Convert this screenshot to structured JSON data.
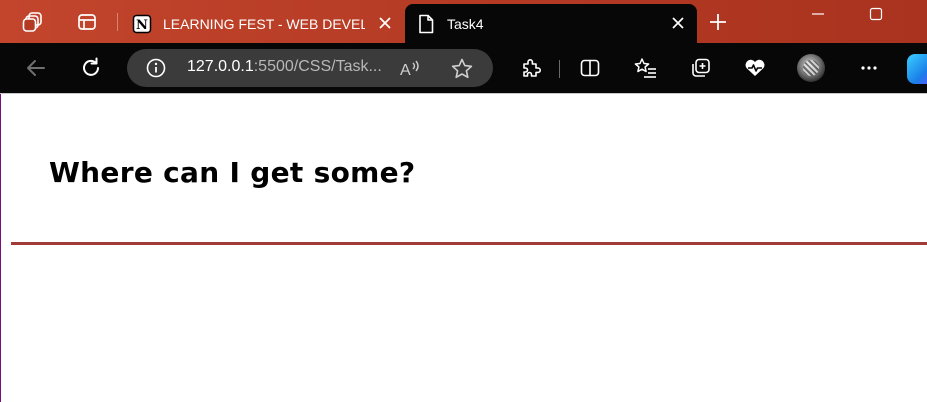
{
  "colors": {
    "tabstrip": "#b43a24",
    "toolbar": "#070707",
    "address_bar": "#3b3b3b",
    "rule": "#a23a3a"
  },
  "browser": {
    "tabs": [
      {
        "title": "LEARNING FEST - WEB DEVELOP",
        "favicon": "notion-icon",
        "active": false
      },
      {
        "title": "Task4",
        "favicon": "file-icon",
        "active": true
      }
    ],
    "address": {
      "host": "127.0.0.1",
      "path": ":5500/CSS/Task..."
    },
    "icons": {
      "workspaces": "workspaces-icon",
      "tab_actions": "tab-actions-icon",
      "new_tab": "plus-icon",
      "minimize": "minimize-icon",
      "maximize": "maximize-icon",
      "back": "back-arrow-icon",
      "refresh": "refresh-icon",
      "site_info": "info-icon",
      "read_aloud": "read-aloud-icon",
      "favorite": "star-icon",
      "extensions": "puzzle-icon",
      "split_screen": "split-screen-icon",
      "favorites": "favorites-list-icon",
      "collections": "collections-icon",
      "health": "heart-icon",
      "profile": "avatar",
      "more": "more-icon",
      "copilot": "copilot-icon"
    }
  },
  "page": {
    "heading": "Where can I get some?"
  }
}
